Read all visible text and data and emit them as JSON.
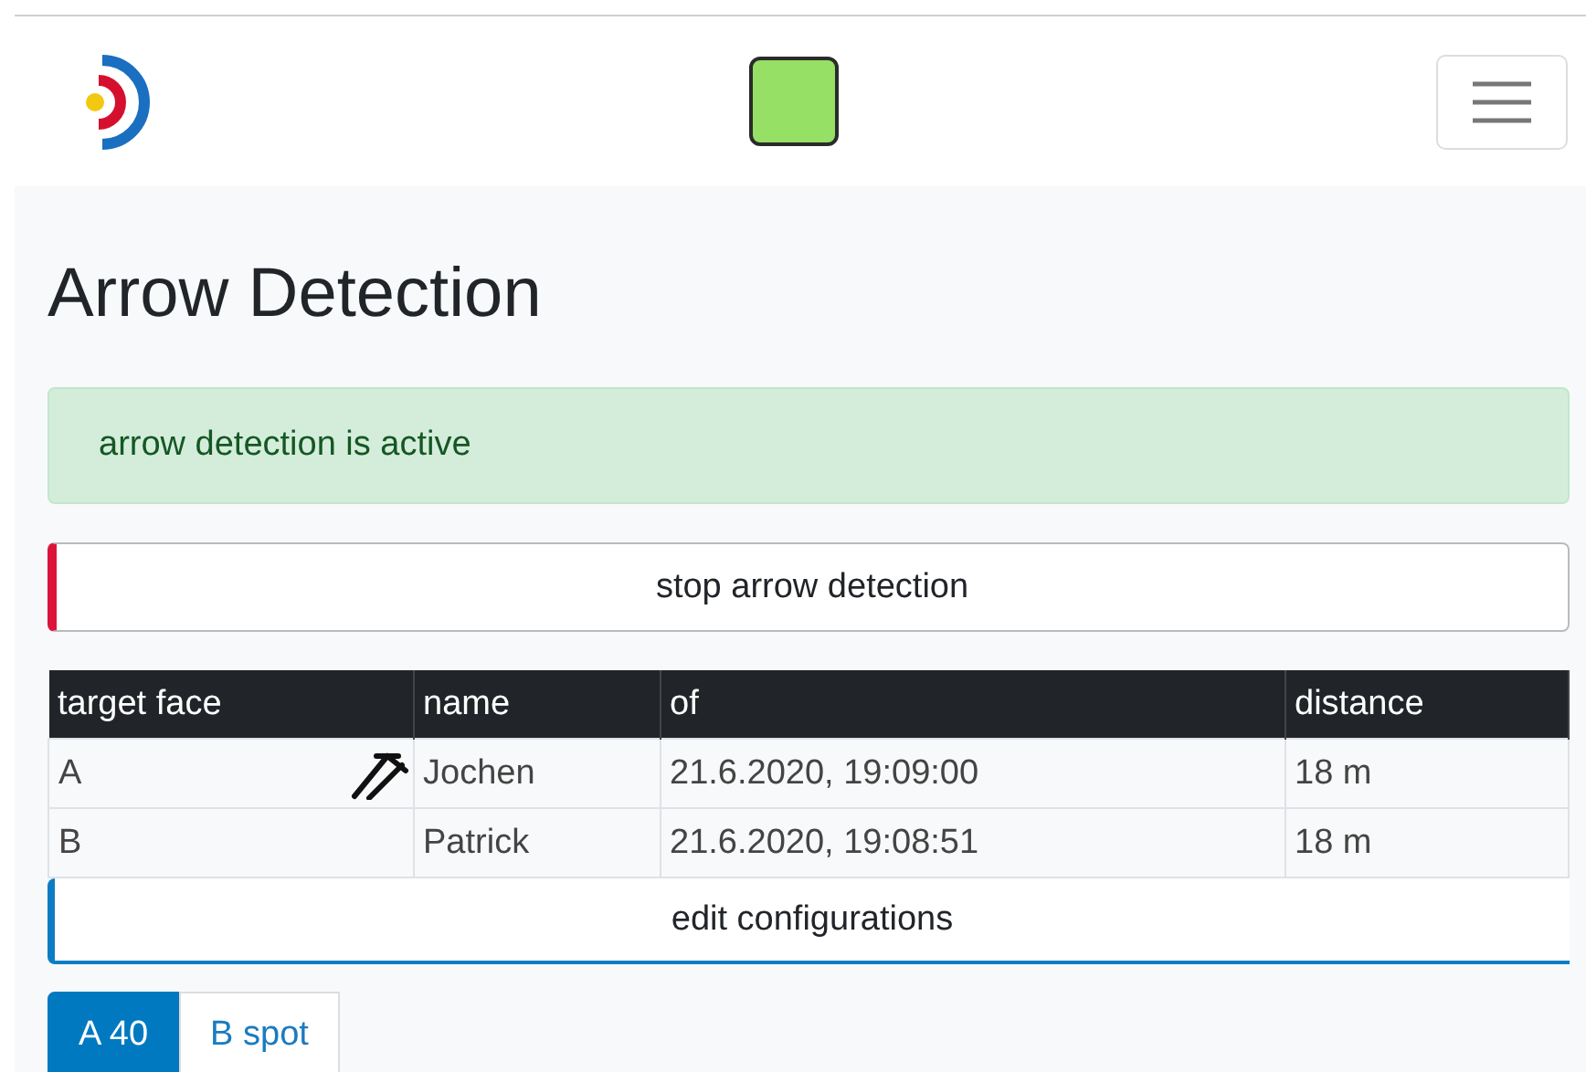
{
  "navbar": {
    "status_indicator": {
      "color": "#95e065"
    }
  },
  "title": "Arrow Detection",
  "alert": {
    "text": "arrow detection is active"
  },
  "stop_button": {
    "label": "stop arrow detection"
  },
  "table": {
    "columns": [
      "target face",
      "name",
      "of",
      "distance"
    ],
    "rows": [
      {
        "cells": [
          "A",
          "Jochen",
          "21.6.2020, 19:09:00",
          "18 m"
        ],
        "arrow_hit": true
      },
      {
        "cells": [
          "B",
          "Patrick",
          "21.6.2020, 19:08:51",
          "18 m"
        ],
        "arrow_hit": false
      }
    ]
  },
  "edit_button": {
    "label": "edit configurations"
  },
  "target_faces": [
    {
      "label": "A 40",
      "selected": true
    },
    {
      "label": "B spot",
      "selected": false
    }
  ]
}
